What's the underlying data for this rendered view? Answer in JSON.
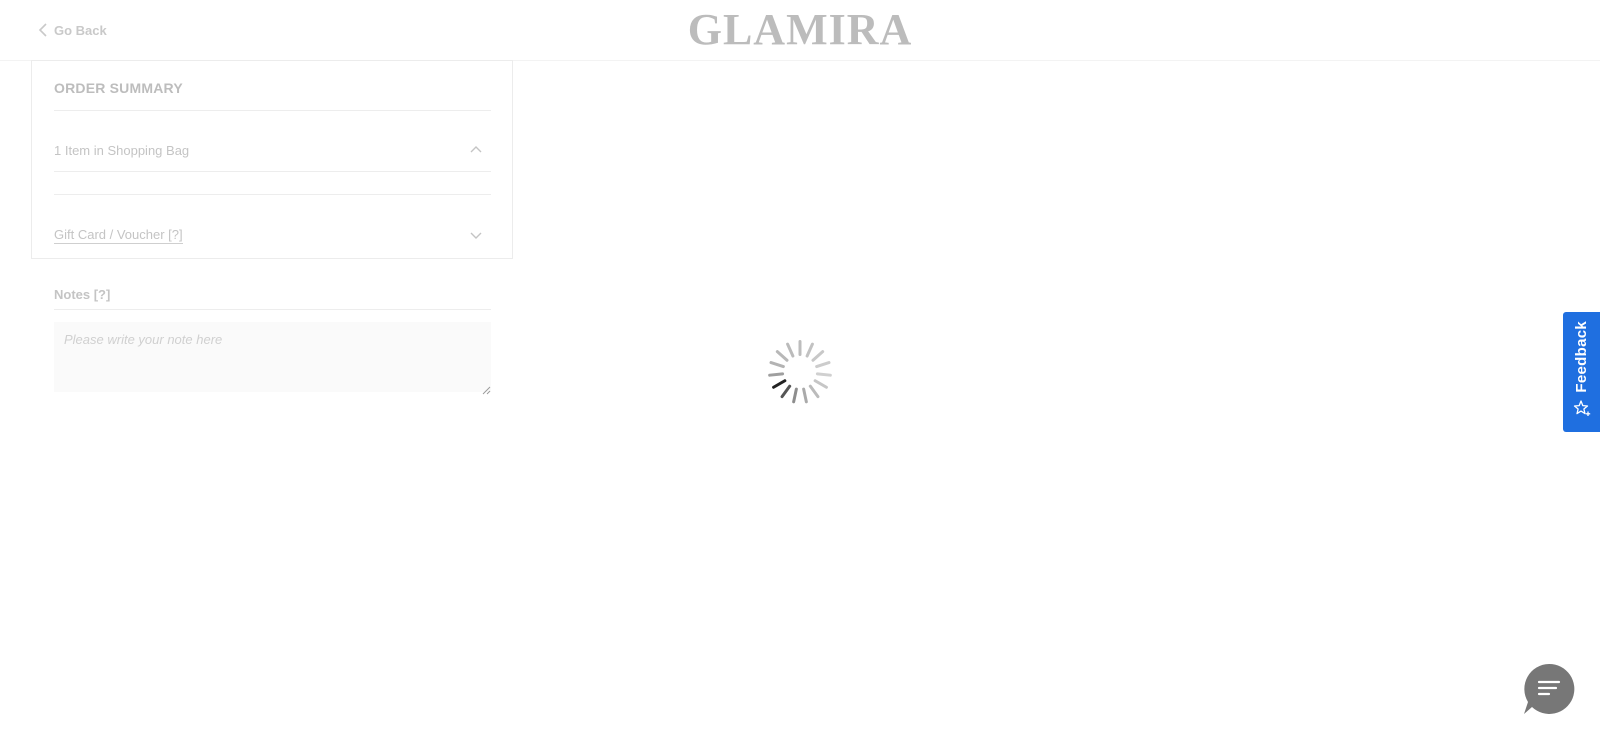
{
  "header": {
    "back_label": "Go Back",
    "logo_text": "GLAMIRA"
  },
  "order_summary": {
    "title": "ORDER SUMMARY",
    "items_label": "1 Item in Shopping Bag",
    "gift_label": "Gift Card / Voucher [?]"
  },
  "notes": {
    "label": "Notes [?]",
    "placeholder": "Please write your note here",
    "value": ""
  },
  "feedback": {
    "label": "Feedback",
    "color": "#1f6fe0"
  },
  "chat": {
    "icon": "chat-menu-icon",
    "color": "#777777"
  },
  "loading": {
    "icon": "loading-spinner-icon"
  }
}
